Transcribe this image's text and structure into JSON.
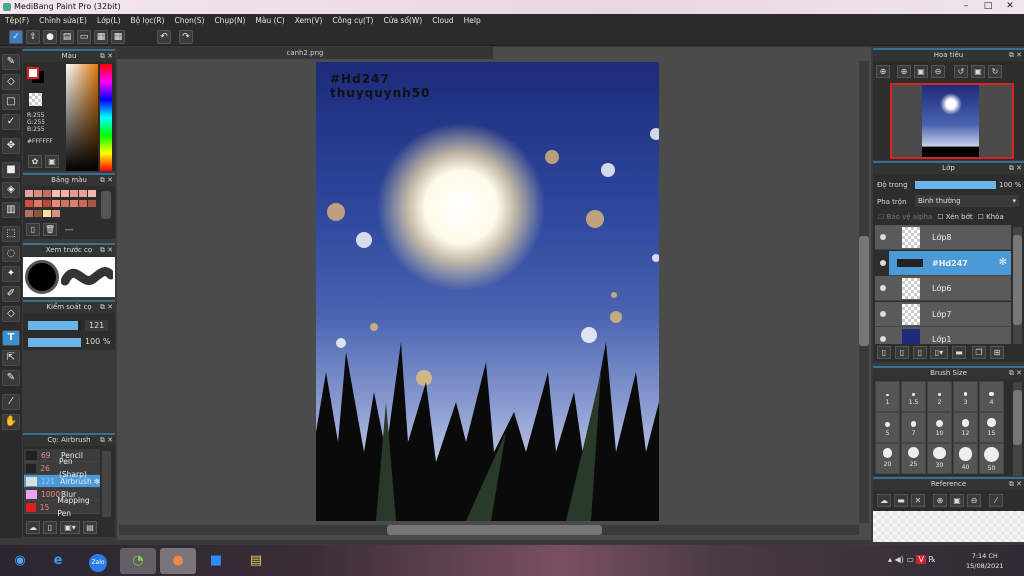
{
  "window": {
    "title": "MediBang Paint Pro (32bit)",
    "controls": [
      "–",
      "□",
      "✕"
    ]
  },
  "menu": [
    "Tệp(F)",
    "Chỉnh sửa(E)",
    "Lớp(L)",
    "Bộ lọc(R)",
    "Chọn(S)",
    "Chụp(N)",
    "Màu (C)",
    "Xem(V)",
    "Công cụ(T)",
    "Cửa sổ(W)",
    "Cloud",
    "Help"
  ],
  "color_panel": {
    "title": "Màu",
    "r": "R:255",
    "g": "G:255",
    "b": "B:255",
    "hex": "#FFFFFF"
  },
  "palette_panel": {
    "title": "Bảng màu",
    "swatches": [
      "#e8a19a",
      "#d98b80",
      "#c07060",
      "#f0c0b8",
      "#f2b0a8",
      "#e89a90",
      "#e8a098",
      "#f0b8b0",
      "#d05040",
      "#e07868",
      "#b84838",
      "#e88878",
      "#d07060",
      "#e08070",
      "#c86858",
      "#a85848",
      "#b07060",
      "#905040",
      "#f8e0a0",
      "#d89088"
    ],
    "separator": "---"
  },
  "brush_preview": {
    "title": "Xem trước cọ"
  },
  "brush_control": {
    "title": "Kiểm soát cọ",
    "size": "121",
    "opacity": "100 %",
    "size_fraction": 0.95,
    "opacity_fraction": 1.0
  },
  "brush_list": {
    "title": "Cọ: Airbrush",
    "items": [
      {
        "size": "69",
        "name": "Pencil",
        "color": "#222"
      },
      {
        "size": "26",
        "name": "Pen (Sharp)",
        "color": "#222"
      },
      {
        "size": "121",
        "name": "Airbrush",
        "color": "#ddd",
        "selected": true
      },
      {
        "size": "1000",
        "name": "Blur",
        "color": "#f0a0f0"
      },
      {
        "size": "15",
        "name": "Mapping Pen",
        "color": "#e02020"
      }
    ]
  },
  "document": {
    "tab": "canh2.png",
    "watermark_line1": "#Hd247",
    "watermark_line2": "thuyquynh50"
  },
  "navigator": {
    "title": "Hoa tiêu"
  },
  "layers": {
    "title": "Lớp",
    "opacity_label": "Độ trong",
    "opacity_value": "100 %",
    "opacity_fraction": 1.0,
    "blend_label": "Pha trộn",
    "blend_value": "Bình thường",
    "protect_alpha": "Bảo vệ alpha",
    "clip": "Xén bớt",
    "lock": "Khóa",
    "items": [
      {
        "name": "Lớp8"
      },
      {
        "name": "#Hd247",
        "selected": true
      },
      {
        "name": "Lớp6"
      },
      {
        "name": "Lớp7"
      },
      {
        "name": "Lớp1"
      }
    ]
  },
  "brush_size": {
    "title": "Brush Size",
    "sizes": [
      "1",
      "1.5",
      "2",
      "3",
      "4",
      "5",
      "7",
      "10",
      "12",
      "15",
      "20",
      "25",
      "30",
      "40",
      "50"
    ]
  },
  "reference": {
    "title": "Reference"
  },
  "taskbar": {
    "time": "7:14 CH",
    "date": "15/08/2021",
    "apps": [
      "start",
      "ie",
      "zalo",
      "coccoc",
      "medibang",
      "zoom",
      "explorer"
    ]
  }
}
